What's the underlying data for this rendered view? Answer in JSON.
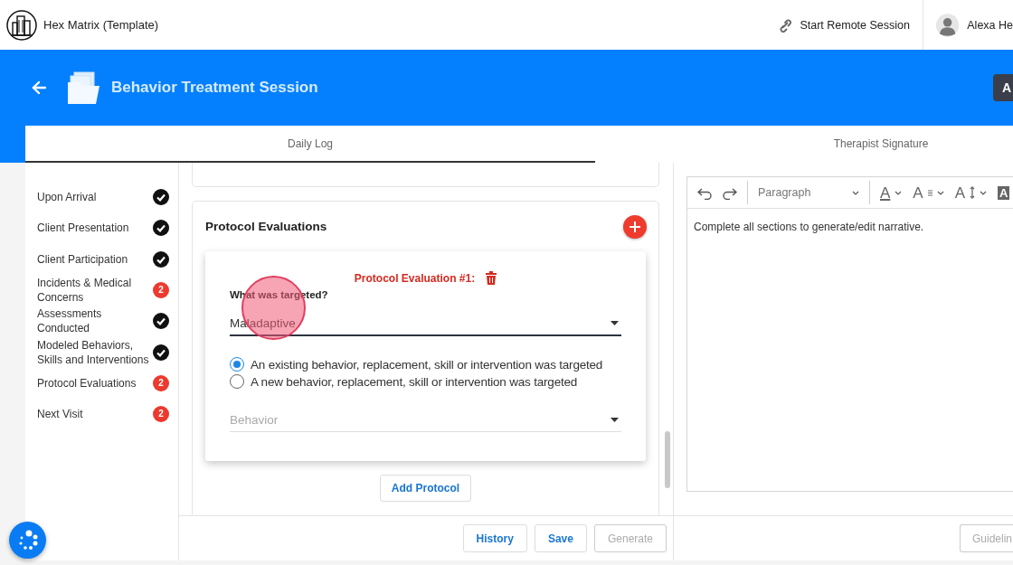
{
  "app": {
    "title": "Hex Matrix (Template)"
  },
  "top_actions": {
    "remote_session": "Start Remote Session",
    "user_name": "Alexa He"
  },
  "header": {
    "title": "Behavior Treatment Session",
    "action_button": "A"
  },
  "tabs": [
    {
      "label": "Daily Log",
      "selected": true
    },
    {
      "label": "Therapist Signature",
      "selected": false
    }
  ],
  "sidebar": {
    "items": [
      {
        "label": "Upon Arrival",
        "complete": true
      },
      {
        "label": "Client Presentation",
        "complete": true
      },
      {
        "label": "Client Participation",
        "complete": true
      },
      {
        "label": "Incidents & Medical Concerns",
        "complete": false,
        "count": "2"
      },
      {
        "label": "Assessments Conducted",
        "complete": true
      },
      {
        "label": "Modeled Behaviors, Skills and Interventions",
        "complete": true
      },
      {
        "label": "Protocol Evaluations",
        "complete": false,
        "count": "2"
      },
      {
        "label": "Next Visit",
        "complete": false,
        "count": "2"
      }
    ]
  },
  "protocol_section": {
    "title": "Protocol Evaluations",
    "evaluations": [
      {
        "title": "Protocol Evaluation #1:",
        "question": "What was targeted?",
        "target_value": "Maladaptive",
        "options": [
          {
            "label": "An existing behavior, replacement, skill or intervention was targeted",
            "selected": true
          },
          {
            "label": "A new behavior, replacement, skill or intervention was targeted",
            "selected": false
          }
        ],
        "behavior_placeholder": "Behavior"
      }
    ],
    "add_button": "Add Protocol"
  },
  "footer_buttons": [
    {
      "label": "History",
      "disabled": false
    },
    {
      "label": "Save",
      "disabled": false
    },
    {
      "label": "Generate",
      "disabled": true
    }
  ],
  "editor": {
    "toolbar": [
      {
        "kind": "undo"
      },
      {
        "kind": "redo"
      },
      {
        "kind": "select",
        "label": "Paragraph"
      },
      {
        "kind": "font-color",
        "glyph": "A"
      },
      {
        "kind": "font-size",
        "glyph": "A"
      },
      {
        "kind": "line-height",
        "glyph": "A"
      },
      {
        "kind": "highlight",
        "glyph": "A"
      }
    ],
    "text": "Complete all sections to generate/edit narrative.",
    "footer_button": {
      "label": "Guidelin",
      "disabled": true
    }
  }
}
